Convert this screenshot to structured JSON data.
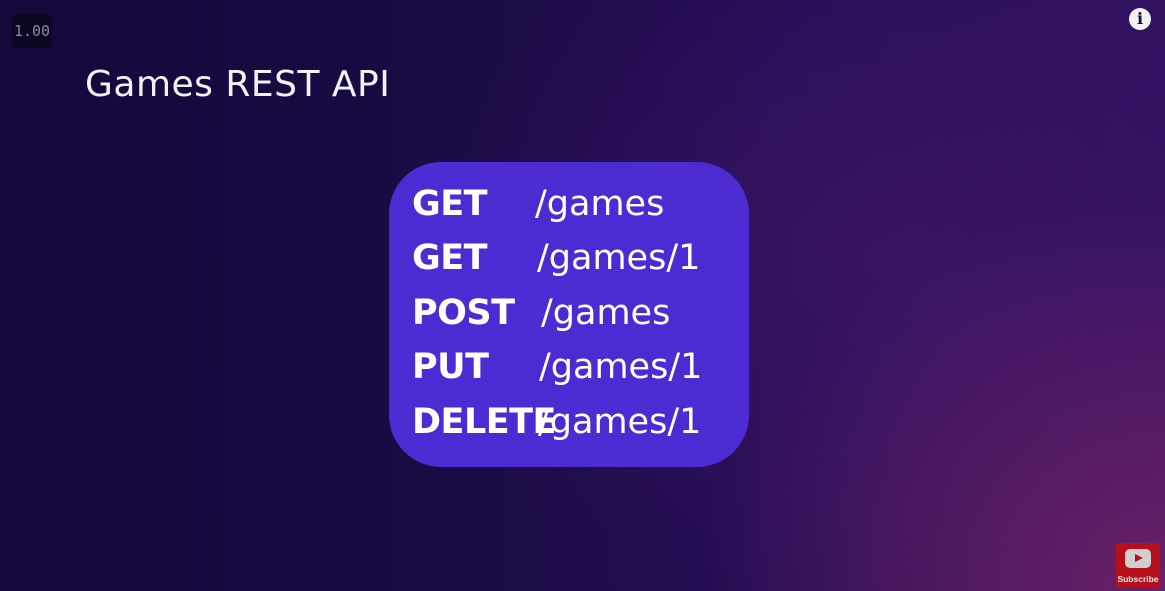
{
  "player": {
    "speed": "1.00",
    "info_icon": "info-icon",
    "subscribe_label": "Subscribe",
    "subscribe_icon": "youtube-icon"
  },
  "slide": {
    "title": "Games REST API",
    "endpoints": [
      {
        "method": "GET",
        "path": "/games"
      },
      {
        "method": "GET",
        "path": "/games/1"
      },
      {
        "method": "POST",
        "path": "/games"
      },
      {
        "method": "PUT",
        "path": "/games/1"
      },
      {
        "method": "DELETE",
        "path": "/games/1"
      }
    ]
  },
  "colors": {
    "card": "#4d2bd3",
    "background": "#1a0b45",
    "subscribe": "#b5101c"
  }
}
